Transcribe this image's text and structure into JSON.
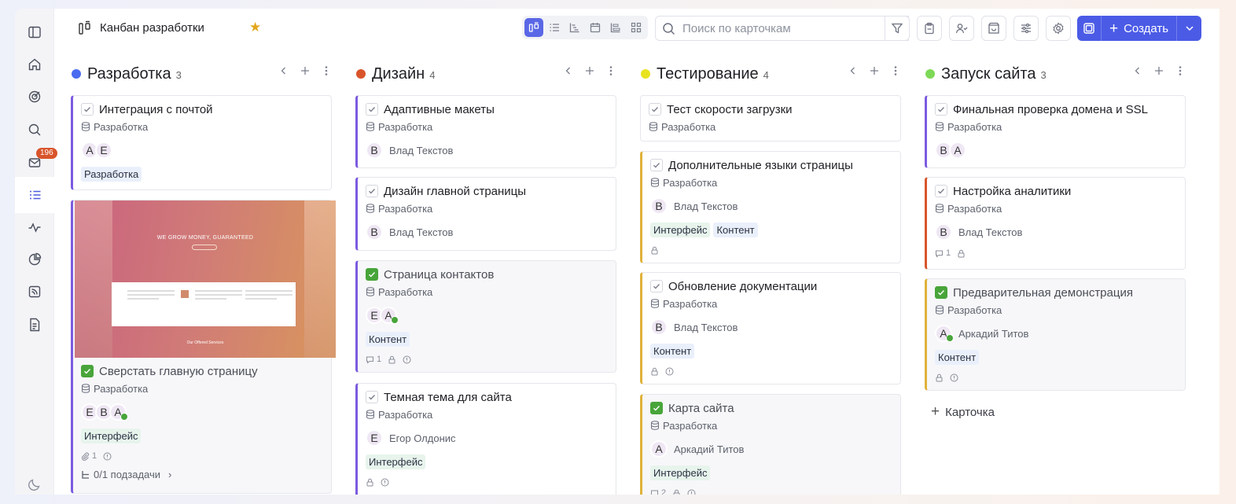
{
  "header": {
    "board_title": "Канбан разработки",
    "search_placeholder": "Поиск по карточкам",
    "create_label": "Создать"
  },
  "sidebar": {
    "inbox_badge": "196",
    "items": [
      "panel-toggle",
      "home",
      "goals",
      "search",
      "inbox",
      "tasks",
      "activity",
      "reports",
      "feeds",
      "documents"
    ]
  },
  "colors": {
    "accent": "#4b5be6",
    "dev": "#4a6cf0",
    "design": "#d9542b",
    "test": "#e8e320",
    "launch": "#7ed957",
    "done_check": "#48a53a"
  },
  "columns": [
    {
      "title": "Разработка",
      "count": "3",
      "cards": [
        {
          "title": "Интеграция с почтой",
          "project": "Разработка",
          "avatars": [
            "А",
            "Е"
          ],
          "tags": [
            "Разработка"
          ]
        },
        {
          "title": "Сверстать главную страницу",
          "project": "Разработка",
          "avatars": [
            "Е",
            "В",
            "А"
          ],
          "tags": [
            "Интерфейс"
          ],
          "attachments": "1",
          "subtasks": "0/1 подзадачи",
          "preview": {
            "headline": "WE GROW MONEY, GUARANTEED",
            "footer": "Our Offered Services"
          }
        }
      ]
    },
    {
      "title": "Дизайн",
      "count": "4",
      "cards": [
        {
          "title": "Адаптивные макеты",
          "project": "Разработка",
          "avatar": "В",
          "person": "Влад Текстов"
        },
        {
          "title": "Дизайн главной страницы",
          "project": "Разработка",
          "avatar": "В",
          "person": "Влад Текстов"
        },
        {
          "title": "Страница контактов",
          "project": "Разработка",
          "avatars": [
            "Е",
            "А"
          ],
          "tags": [
            "Контент"
          ],
          "comments": "1"
        },
        {
          "title": "Темная тема для сайта",
          "project": "Разработка",
          "avatar": "Е",
          "person": "Егор Олдонис",
          "tags": [
            "Интерфейс"
          ]
        }
      ]
    },
    {
      "title": "Тестирование",
      "count": "4",
      "cards": [
        {
          "title": "Тест скорости загрузки",
          "project": "Разработка"
        },
        {
          "title": "Дополнительные языки страницы",
          "project": "Разработка",
          "avatar": "В",
          "person": "Влад Текстов",
          "tags": [
            "Интерфейс",
            "Контент"
          ]
        },
        {
          "title": "Обновление документации",
          "project": "Разработка",
          "avatar": "В",
          "person": "Влад Текстов",
          "tags": [
            "Контент"
          ]
        },
        {
          "title": "Карта сайта",
          "project": "Разработка",
          "avatar": "А",
          "person": "Аркадий Титов",
          "tags": [
            "Интерфейс"
          ],
          "comments": "2"
        }
      ]
    },
    {
      "title": "Запуск сайта",
      "count": "3",
      "cards": [
        {
          "title": "Финальная проверка домена и SSL",
          "project": "Разработка",
          "avatars": [
            "В",
            "А"
          ]
        },
        {
          "title": "Настройка аналитики",
          "project": "Разработка",
          "avatar": "В",
          "person": "Влад Текстов",
          "comments": "1"
        },
        {
          "title": "Предварительная демонстрация",
          "project": "Разработка",
          "avatar": "А",
          "person": "Аркадий Титов",
          "tags": [
            "Контент"
          ]
        }
      ],
      "add_card_label": "Карточка"
    }
  ]
}
